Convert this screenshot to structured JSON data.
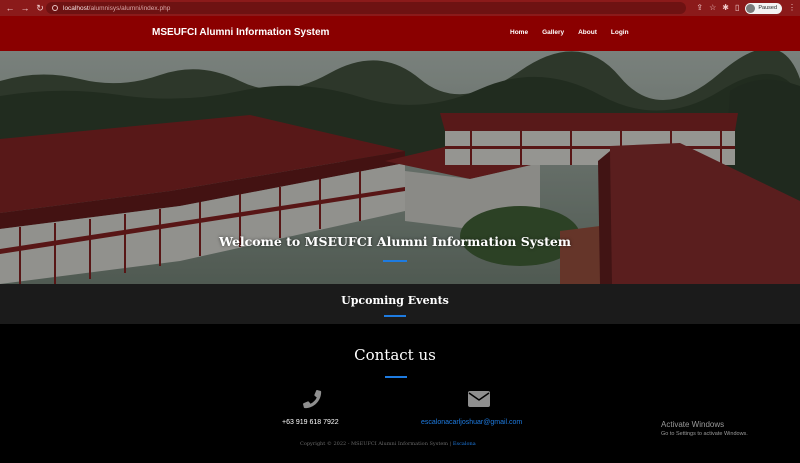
{
  "browser": {
    "url_host": "localhost",
    "url_path": "/alumnisys/alumni/index.php",
    "profile_label": "Paused"
  },
  "navbar": {
    "brand": "MSEUFCI Alumni Information System",
    "menu": [
      "Home",
      "Gallery",
      "About",
      "Login"
    ]
  },
  "hero": {
    "title": "Welcome to MSEUFCI Alumni Information System"
  },
  "events": {
    "title": "Upcoming Events"
  },
  "contact": {
    "title": "Contact us",
    "phone": "+63 919 618 7922",
    "email": "escalonacarljoshuar@gmail.com",
    "copyright": "Copyright © 2022 - MSEUFCI Alumni Information System |",
    "copyright_link": "Escalona"
  },
  "windows": {
    "activate_title": "Activate Windows",
    "activate_sub": "Go to Settings to activate Windows."
  },
  "colors": {
    "navbar": "#8a0000",
    "accent": "#1e7be0",
    "events_bg": "#1b1b1b"
  }
}
